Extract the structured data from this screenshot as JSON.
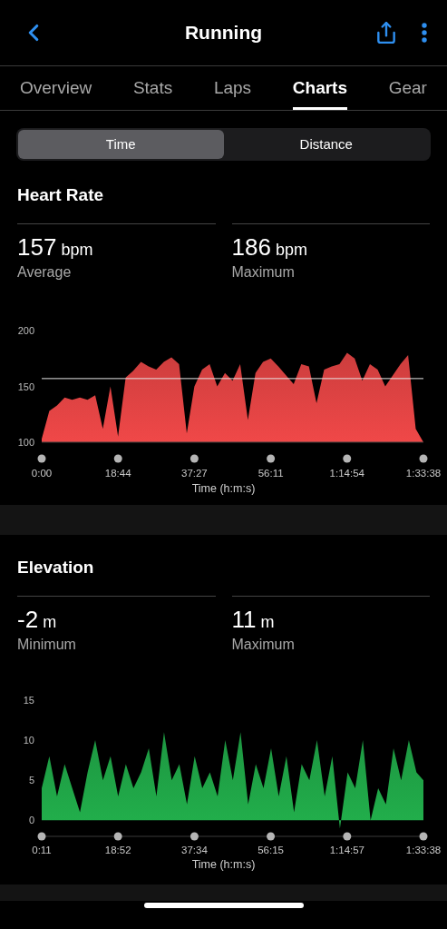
{
  "header": {
    "title": "Running"
  },
  "tabs": [
    {
      "label": "Overview",
      "selected": false
    },
    {
      "label": "Stats",
      "selected": false
    },
    {
      "label": "Laps",
      "selected": false
    },
    {
      "label": "Charts",
      "selected": true
    },
    {
      "label": "Gear",
      "selected": false
    }
  ],
  "segments": [
    {
      "label": "Time",
      "selected": true
    },
    {
      "label": "Distance",
      "selected": false
    }
  ],
  "sections": [
    {
      "title": "Heart Rate",
      "stats": [
        {
          "value": "157",
          "unit": "bpm",
          "label": "Average"
        },
        {
          "value": "186",
          "unit": "bpm",
          "label": "Maximum"
        }
      ],
      "chart_data": {
        "type": "area",
        "xlabel": "Time (h:m:s)",
        "xlim": [
          0,
          5618
        ],
        "ylim": [
          100,
          200
        ],
        "yticks": [
          100,
          150,
          200
        ],
        "x": [
          0,
          112,
          225,
          337,
          449,
          562,
          674,
          787,
          899,
          1011,
          1124,
          1236,
          1348,
          1461,
          1573,
          1685,
          1798,
          1910,
          2022,
          2135,
          2247,
          2360,
          2472,
          2584,
          2697,
          2809,
          2921,
          3034,
          3146,
          3258,
          3371,
          3483,
          3595,
          3708,
          3820,
          3932,
          4045,
          4157,
          4269,
          4382,
          4494,
          4607,
          4719,
          4831,
          4944,
          5056,
          5168,
          5281,
          5393,
          5505,
          5618
        ],
        "xticks": [
          {
            "value": 0,
            "label": "0:00"
          },
          {
            "value": 1124,
            "label": "18:44"
          },
          {
            "value": 2247,
            "label": "37:27"
          },
          {
            "value": 3371,
            "label": "56:11"
          },
          {
            "value": 4494,
            "label": "1:14:54"
          },
          {
            "value": 5618,
            "label": "1:33:38"
          }
        ],
        "series": [
          {
            "color": "#f04848",
            "values": [
              103,
              128,
              133,
              140,
              138,
              140,
              138,
              142,
              112,
              150,
              105,
              158,
              164,
              172,
              168,
              165,
              172,
              176,
              170,
              108,
              150,
              165,
              170,
              150,
              162,
              155,
              170,
              120,
              162,
              172,
              175,
              168,
              160,
              152,
              170,
              168,
              135,
              165,
              168,
              170,
              180,
              175,
              155,
              170,
              165,
              150,
              160,
              170,
              178,
              112,
              100
            ]
          }
        ],
        "ref_lines": [
          {
            "axis": "y",
            "value": 157
          }
        ]
      }
    },
    {
      "title": "Elevation",
      "stats": [
        {
          "value": "-2",
          "unit": "m",
          "label": "Minimum"
        },
        {
          "value": "11",
          "unit": "m",
          "label": "Maximum"
        }
      ],
      "chart_data": {
        "type": "area",
        "xlabel": "Time (h:m:s)",
        "xlim": [
          11,
          5618
        ],
        "ylim": [
          -2,
          15
        ],
        "yticks": [
          0,
          5,
          10,
          15
        ],
        "x": [
          11,
          123,
          236,
          348,
          460,
          573,
          685,
          797,
          910,
          1022,
          1134,
          1247,
          1359,
          1471,
          1584,
          1696,
          1808,
          1921,
          2033,
          2145,
          2258,
          2370,
          2482,
          2595,
          2707,
          2819,
          2932,
          3044,
          3156,
          3269,
          3381,
          3493,
          3606,
          3718,
          3830,
          3943,
          4055,
          4167,
          4280,
          4392,
          4504,
          4617,
          4729,
          4841,
          4954,
          5066,
          5178,
          5291,
          5403,
          5515,
          5618
        ],
        "xticks": [
          {
            "value": 11,
            "label": "0:11"
          },
          {
            "value": 1132,
            "label": "18:52"
          },
          {
            "value": 2254,
            "label": "37:34"
          },
          {
            "value": 3375,
            "label": "56:15"
          },
          {
            "value": 4497,
            "label": "1:14:57"
          },
          {
            "value": 5618,
            "label": "1:33:38"
          }
        ],
        "series": [
          {
            "color": "#22b04c",
            "values": [
              4,
              8,
              3,
              7,
              4,
              1,
              6,
              10,
              5,
              8,
              3,
              7,
              4,
              6,
              9,
              3,
              11,
              5,
              7,
              2,
              8,
              4,
              6,
              3,
              10,
              5,
              11,
              2,
              7,
              4,
              9,
              3,
              8,
              1,
              7,
              5,
              10,
              3,
              8,
              -1,
              6,
              4,
              10,
              0,
              4,
              2,
              9,
              5,
              10,
              6,
              5
            ]
          }
        ]
      }
    }
  ]
}
